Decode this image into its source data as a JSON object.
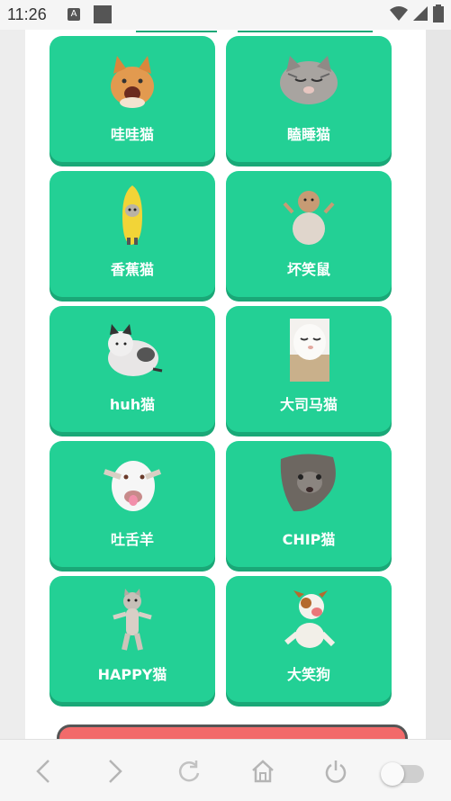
{
  "status_bar": {
    "time": "11:26",
    "a_badge": "A"
  },
  "cards": [
    {
      "label": "哇哇猫",
      "icon": "orange-cat-icon"
    },
    {
      "label": "瞌睡猫",
      "icon": "sleepy-cat-icon"
    },
    {
      "label": "香蕉猫",
      "icon": "banana-cat-icon"
    },
    {
      "label": "坏笑鼠",
      "icon": "capybara-icon"
    },
    {
      "label": "huh猫",
      "icon": "huh-cat-icon"
    },
    {
      "label": "大司马猫",
      "icon": "white-cat-icon"
    },
    {
      "label": "吐舌羊",
      "icon": "goat-icon"
    },
    {
      "label": "CHIP猫",
      "icon": "chip-cat-icon"
    },
    {
      "label": "HAPPY猫",
      "icon": "happy-cat-icon"
    },
    {
      "label": "大笑狗",
      "icon": "dog-icon"
    }
  ],
  "colors": {
    "card": "#23d095",
    "card_shadow": "#1aa877",
    "red_button": "#f26a6a"
  }
}
